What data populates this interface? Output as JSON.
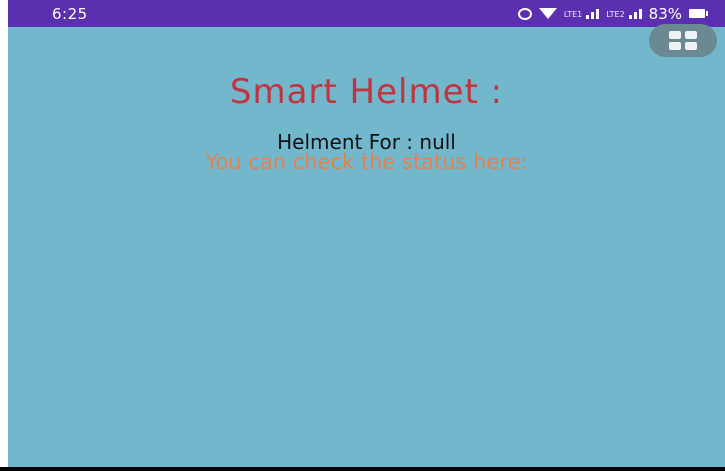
{
  "status_bar": {
    "time": "6:25",
    "signal_1_label": "LTE1",
    "signal_2_label": "LTE2",
    "battery": "83%",
    "icons": [
      "alarm-icon",
      "wifi-icon",
      "signal-icon",
      "signal-icon",
      "battery-icon"
    ]
  },
  "menu": {
    "icon": "grid-menu-icon"
  },
  "main": {
    "title": "Smart Helmet :",
    "helmet_for": "Helment For : null",
    "hint": "You can check the status here:"
  },
  "colors": {
    "status_bar": "#5a2fb0",
    "background": "#72b7cb",
    "title": "#c0343e",
    "hint": "#e8804c"
  }
}
